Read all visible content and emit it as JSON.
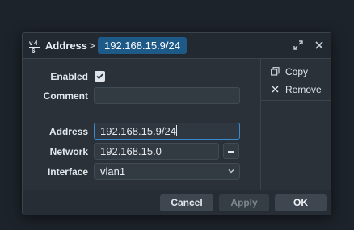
{
  "titlebar": {
    "app_icon": "ipv4-icon",
    "section": "Address",
    "separator": ">",
    "item": "192.168.15.9/24",
    "restore_icon": "restore-icon",
    "close_icon": "close-icon"
  },
  "form": {
    "enabled": {
      "label": "Enabled",
      "checked": true
    },
    "comment": {
      "label": "Comment",
      "value": ""
    },
    "address": {
      "label": "Address",
      "value": "192.168.15.9/24"
    },
    "network": {
      "label": "Network",
      "value": "192.168.15.0"
    },
    "interface": {
      "label": "Interface",
      "value": "vlan1"
    }
  },
  "sidebar": {
    "copy": {
      "label": "Copy",
      "icon": "copy-icon"
    },
    "remove": {
      "label": "Remove",
      "icon": "remove-icon"
    }
  },
  "footer": {
    "cancel": "Cancel",
    "apply": "Apply",
    "ok": "OK"
  },
  "colors": {
    "accent": "#1e5a88",
    "focus_border": "#3a8ad0",
    "background": "#1d232a",
    "dialog": "#2a3138"
  }
}
